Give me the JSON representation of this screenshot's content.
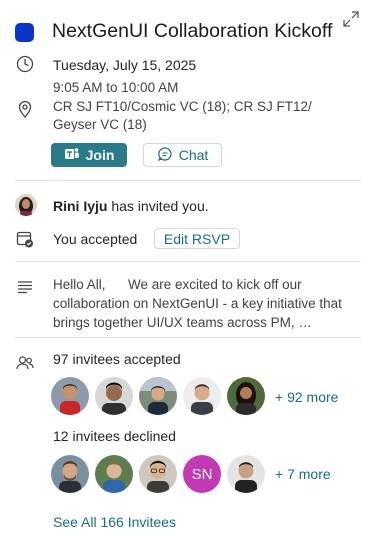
{
  "event": {
    "title": "NextGenUI Collaboration Kickoff",
    "color": "#0b35c4",
    "date": "Tuesday, July 15, 2025",
    "time": "9:05 AM to 10:00 AM",
    "location_line1": "CR SJ FT10/Cosmic VC (18); CR SJ FT12/",
    "location_line2": "Geyser VC (18)"
  },
  "actions": {
    "join_label": "Join",
    "chat_label": "Chat"
  },
  "organizer": {
    "name": "Rini Iyju",
    "invite_text": " has invited you."
  },
  "response": {
    "status": "You accepted",
    "edit_label": "Edit RSVP"
  },
  "description": "Hello All,      We are excited to kick off our collaboration on NextGenUI - a key initiative that brings together UI/UX teams across PM, Engineering, and Design",
  "attendees": {
    "accepted_label": "97 invitees accepted",
    "accepted_more": "+ 92 more",
    "declined_label": "12 invitees declined",
    "declined_initials": "SN",
    "declined_more": "+ 7 more",
    "see_all": "See All 166 Invitees"
  },
  "icons": {
    "expand": "expand-icon",
    "clock": "clock-icon",
    "location": "location-pin-icon",
    "teams": "teams-icon",
    "chat": "chat-bubble-icon",
    "calendar_check": "calendar-check-icon",
    "description": "text-lines-icon",
    "people": "people-icon"
  },
  "colors": {
    "accent": "#1a6d7d",
    "join_button": "#2b7a88",
    "initials_avatar": "#c239b3"
  }
}
